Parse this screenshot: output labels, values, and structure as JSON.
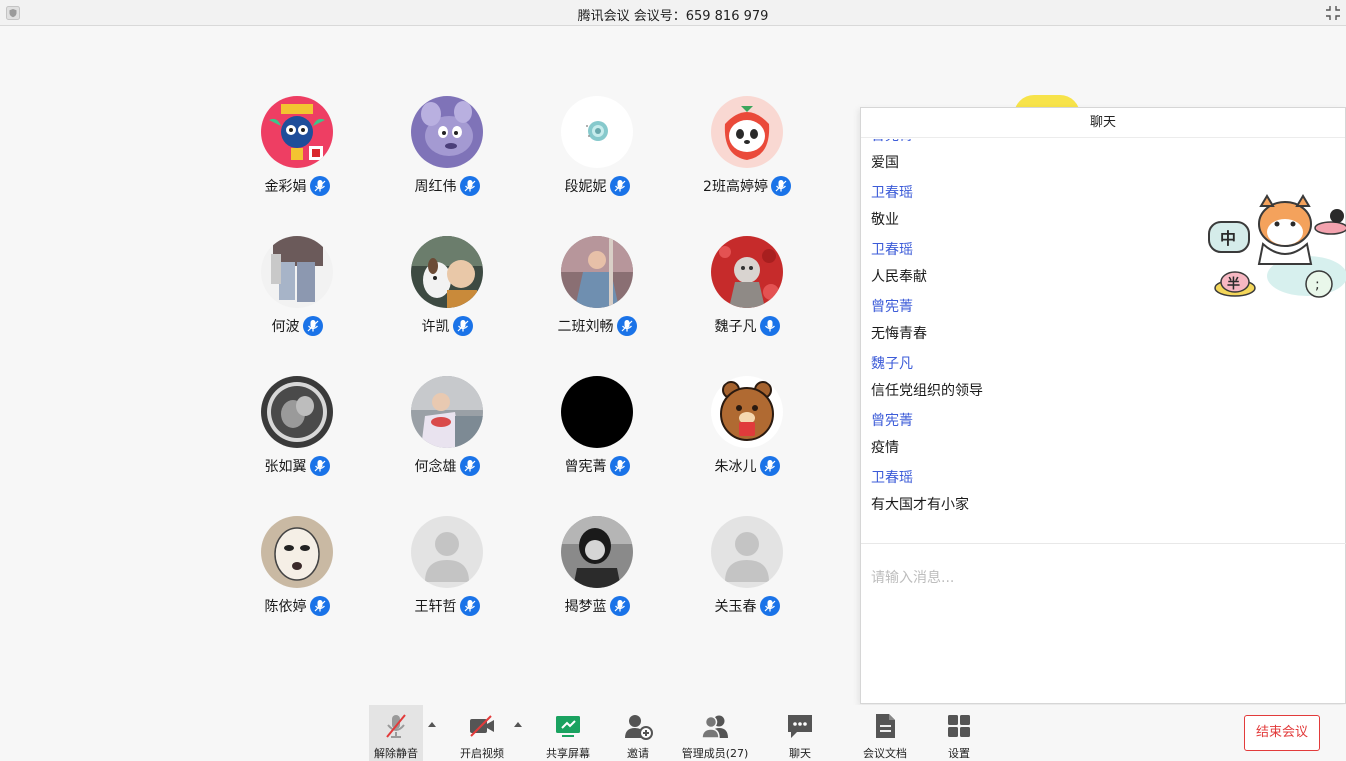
{
  "window": {
    "title": "腾讯会议 会议号：659 816 979"
  },
  "participants": [
    {
      "name": "金彩娟",
      "avatar": "mascot"
    },
    {
      "name": "周红伟",
      "avatar": "cartoon-mouse"
    },
    {
      "name": "段妮妮",
      "avatar": "shell"
    },
    {
      "name": "2班高婷婷",
      "avatar": "strawberry-bear"
    },
    {
      "name": "何波",
      "avatar": "photo"
    },
    {
      "name": "许凯",
      "avatar": "photo-dog"
    },
    {
      "name": "二班刘畅",
      "avatar": "photo"
    },
    {
      "name": "魏子凡",
      "avatar": "photo-red"
    },
    {
      "name": "张如翼",
      "avatar": "photo-bw"
    },
    {
      "name": "何念雄",
      "avatar": "photo"
    },
    {
      "name": "曾宪菁",
      "avatar": "black"
    },
    {
      "name": "朱冰儿",
      "avatar": "bear"
    },
    {
      "name": "陈依婷",
      "avatar": "mask-face"
    },
    {
      "name": "王轩哲",
      "avatar": "default"
    },
    {
      "name": "揭梦蓝",
      "avatar": "photo-bw"
    },
    {
      "name": "关玉春",
      "avatar": "default"
    }
  ],
  "chat": {
    "title": "聊天",
    "messages": [
      {
        "sender": "曾宪菁",
        "text": "爱国"
      },
      {
        "sender": "卫春瑶",
        "text": "敬业"
      },
      {
        "sender": "卫春瑶",
        "text": "人民奉献"
      },
      {
        "sender": "曾宪菁",
        "text": "无悔青春"
      },
      {
        "sender": "魏子凡",
        "text": "信任党组织的领导"
      },
      {
        "sender": "曾宪菁",
        "text": "疫情"
      },
      {
        "sender": "卫春瑶",
        "text": "有大国才有小家"
      }
    ],
    "sticker_chars": [
      "中",
      "半",
      ";"
    ],
    "input_placeholder": "请输入消息..."
  },
  "toolbar": {
    "unmute": "解除静音",
    "start_video": "开启视频",
    "share_screen": "共享屏幕",
    "invite": "邀请",
    "manage_members": "管理成员(27)",
    "chat": "聊天",
    "meeting_docs": "会议文档",
    "settings": "设置",
    "end_meeting": "结束会议"
  },
  "colors": {
    "accent": "#1a73e8",
    "sender": "#3d5cd8",
    "share_green": "#1aa260",
    "end_red": "#e23b3b"
  }
}
